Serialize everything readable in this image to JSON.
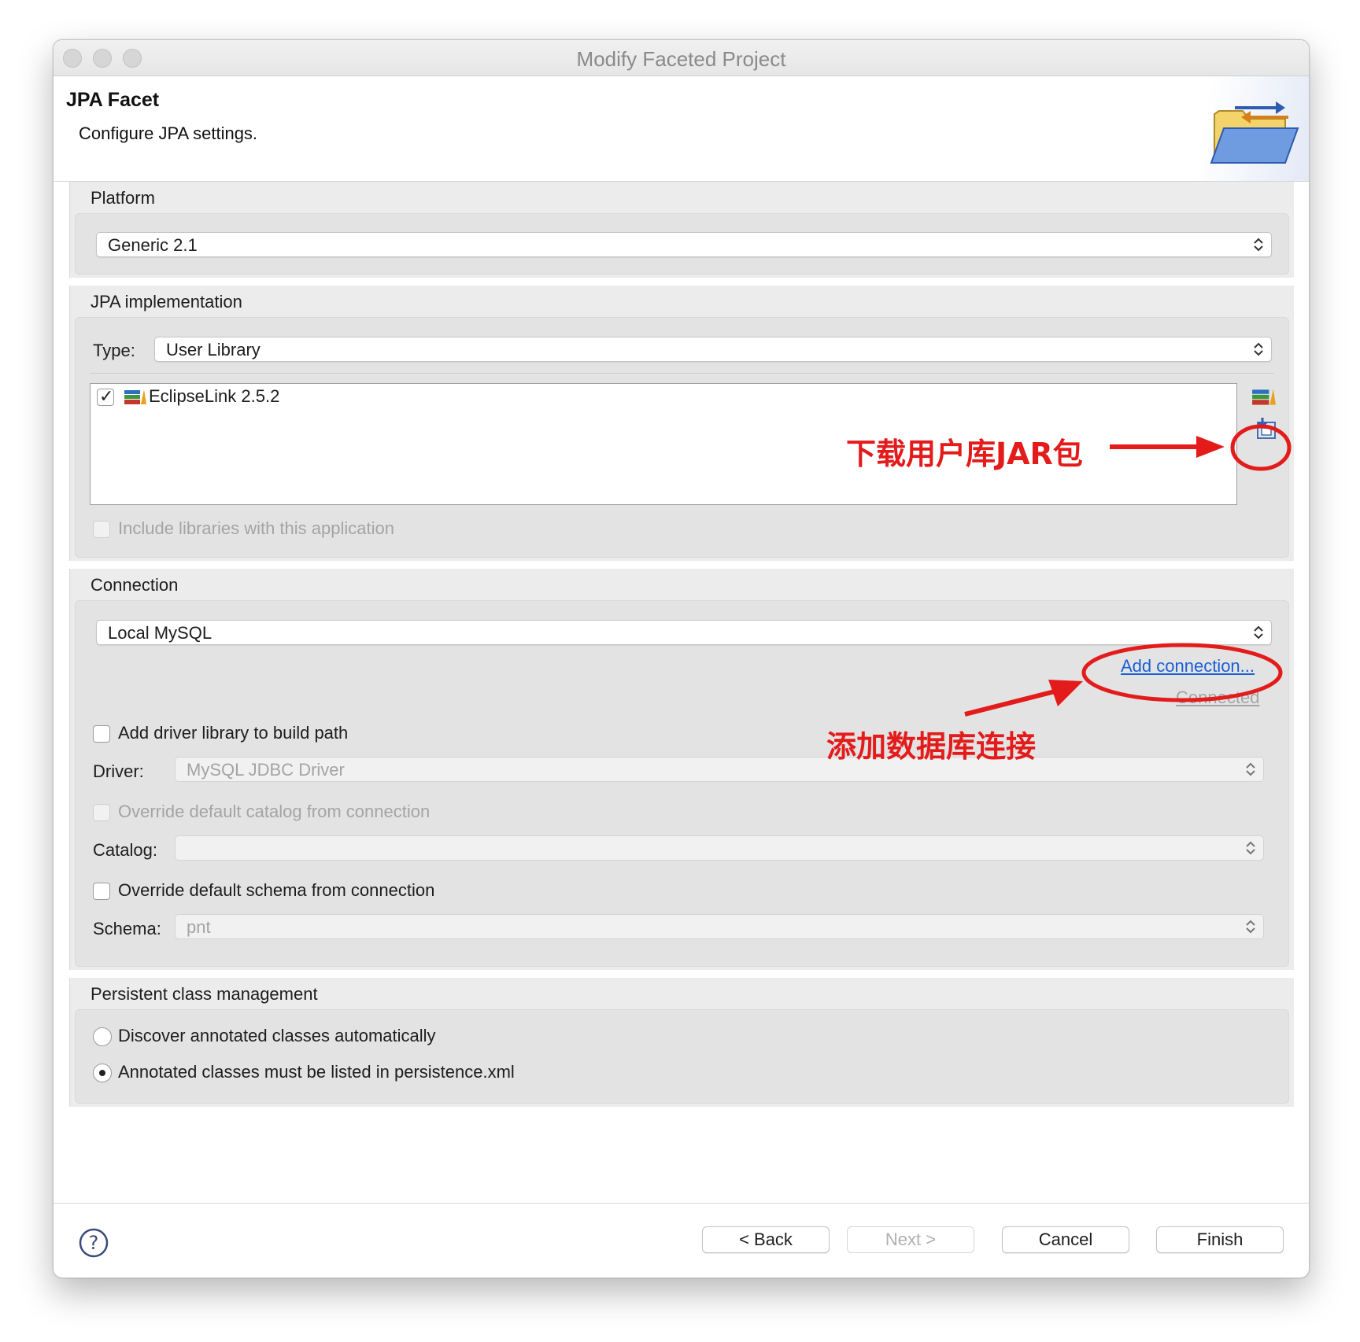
{
  "window": {
    "title": "Modify Faceted Project"
  },
  "header": {
    "title": "JPA Facet",
    "description": "Configure JPA settings."
  },
  "platform": {
    "label": "Platform",
    "selected": "Generic 2.1"
  },
  "jpa_impl": {
    "label": "JPA implementation",
    "type_label": "Type:",
    "type_selected": "User Library",
    "libraries": [
      {
        "name": "EclipseLink 2.5.2",
        "checked": true
      }
    ],
    "include_libraries_label": "Include libraries with this application"
  },
  "connection": {
    "label": "Connection",
    "selected": "Local MySQL",
    "add_connection_link": "Add connection...",
    "connected_link": "Connected",
    "add_driver_label": "Add driver library to build path",
    "driver_label": "Driver:",
    "driver_selected": "MySQL JDBC Driver",
    "override_catalog_label": "Override default catalog from connection",
    "catalog_label": "Catalog:",
    "catalog_selected": "",
    "override_schema_label": "Override default schema from connection",
    "schema_label": "Schema:",
    "schema_selected": "pnt"
  },
  "persistence": {
    "label": "Persistent class management",
    "options": [
      {
        "label": "Discover annotated classes automatically",
        "selected": false
      },
      {
        "label": "Annotated classes must be listed in persistence.xml",
        "selected": true
      }
    ]
  },
  "annotations": {
    "download_jar": "下载用户库JAR包",
    "add_db_connection": "添加数据库连接",
    "color": "#e31b1b"
  },
  "buttons": {
    "back": "< Back",
    "next": "Next >",
    "cancel": "Cancel",
    "finish": "Finish"
  }
}
